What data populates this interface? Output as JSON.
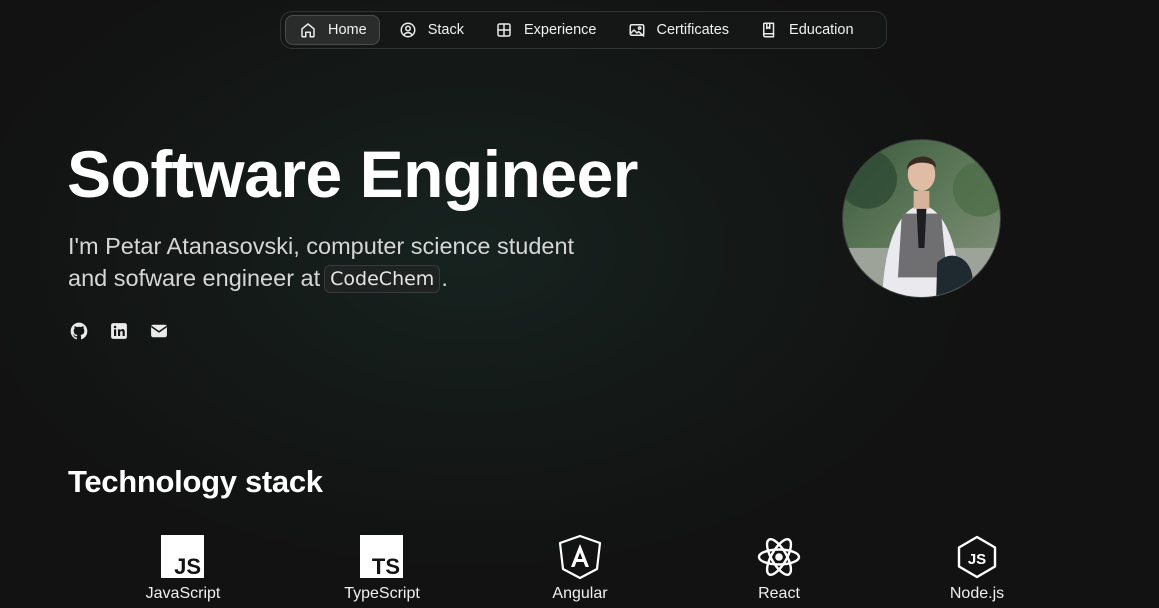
{
  "nav": {
    "items": [
      {
        "label": "Home",
        "icon": "home-icon",
        "active": true
      },
      {
        "label": "Stack",
        "icon": "user-circle-icon"
      },
      {
        "label": "Experience",
        "icon": "grid-icon"
      },
      {
        "label": "Certificates",
        "icon": "image-icon"
      },
      {
        "label": "Education",
        "icon": "book-icon"
      }
    ]
  },
  "hero": {
    "title": "Software Engineer",
    "subtitle_before": "I'm Petar Atanasovski, computer science student and sofware engineer at",
    "company": "CodeChem",
    "subtitle_after": ".",
    "socials": [
      "github-icon",
      "linkedin-icon",
      "mail-icon"
    ]
  },
  "stack": {
    "title": "Technology stack",
    "items": [
      {
        "label": "JavaScript",
        "icon": "javascript-icon"
      },
      {
        "label": "TypeScript",
        "icon": "typescript-icon"
      },
      {
        "label": "Angular",
        "icon": "angular-icon"
      },
      {
        "label": "React",
        "icon": "react-icon"
      },
      {
        "label": "Node.js",
        "icon": "nodejs-icon"
      }
    ]
  },
  "colors": {
    "background": "#121212",
    "text": "#ffffff",
    "muted_text": "#d6d6d6"
  }
}
